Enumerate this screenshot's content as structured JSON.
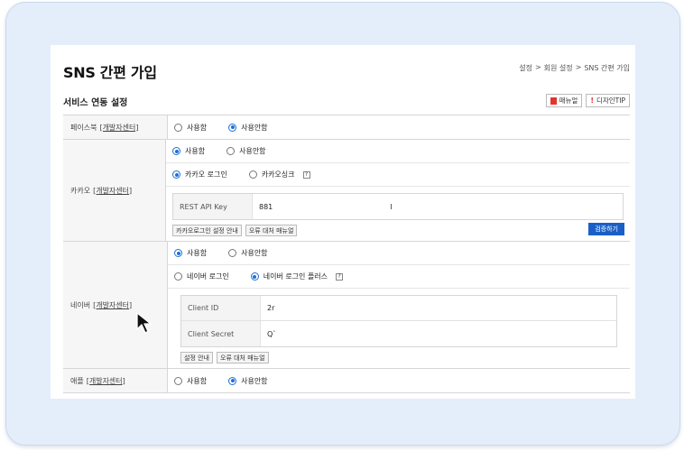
{
  "page": {
    "title": "SNS 간편 가입"
  },
  "breadcrumb": [
    "설정",
    ">",
    "회원 설정",
    ">",
    "SNS 간편 가입"
  ],
  "section": {
    "title": "서비스 연동 설정"
  },
  "top_buttons": {
    "manual": "매뉴얼",
    "design_tip": "디자인TIP"
  },
  "dev_center_link": "[개발자센터]",
  "facebook": {
    "label": "페이스북",
    "options": [
      {
        "label": "사용함",
        "checked": false
      },
      {
        "label": "사용안함",
        "checked": true
      }
    ]
  },
  "kakao": {
    "label": "카카오",
    "options": [
      {
        "label": "사용함",
        "checked": true
      },
      {
        "label": "사용안함",
        "checked": false
      }
    ],
    "modes": [
      {
        "label": "카카오 로그인",
        "checked": true
      },
      {
        "label": "카카오싱크",
        "checked": false
      }
    ],
    "help": "?",
    "fields": [
      {
        "label": "REST API Key",
        "value": "881",
        "value2": "l"
      }
    ],
    "buttons": {
      "guide": "카카오로그인 설정 안내",
      "error_manual": "오류 대처 매뉴얼",
      "verify": "검증하기"
    }
  },
  "naver": {
    "label": "네이버",
    "options": [
      {
        "label": "사용함",
        "checked": true
      },
      {
        "label": "사용안함",
        "checked": false
      }
    ],
    "modes": [
      {
        "label": "네이버 로그인",
        "checked": false
      },
      {
        "label": "네이버 로그인 플러스",
        "checked": true
      }
    ],
    "help": "?",
    "fields": [
      {
        "label": "Client ID",
        "value": "2r"
      },
      {
        "label": "Client Secret",
        "value": "Q`"
      }
    ],
    "buttons": {
      "guide": "설정 안내",
      "error_manual": "오류 대처 매뉴얼"
    }
  },
  "apple": {
    "label": "애플",
    "options": [
      {
        "label": "사용함",
        "checked": false
      },
      {
        "label": "사용안함",
        "checked": true
      }
    ]
  },
  "colors": {
    "accent": "#1f6fd6",
    "button_blue": "#1a5fc7",
    "frame": "#e4eefb"
  },
  "icons": [
    "manual-doc-icon",
    "design-tip-icon",
    "help-icon",
    "mouse-pointer-icon"
  ]
}
